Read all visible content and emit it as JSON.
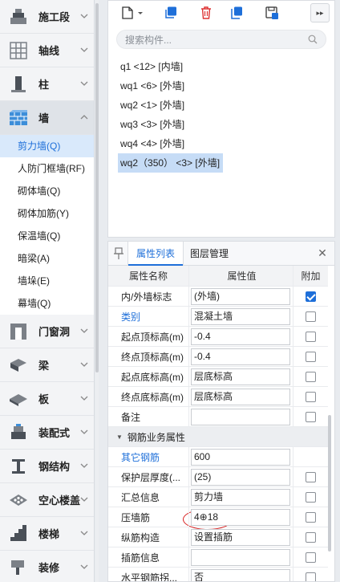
{
  "nav": {
    "categories_top": [
      {
        "label": "施工段",
        "icon": "construction-stage-icon"
      },
      {
        "label": "轴线",
        "icon": "grid-axis-icon"
      },
      {
        "label": "柱",
        "icon": "column-icon"
      }
    ],
    "active_category": {
      "label": "墙",
      "icon": "wall-icon"
    },
    "sub_items": [
      "剪力墙(Q)",
      "人防门框墙(RF)",
      "砌体墙(Q)",
      "砌体加筋(Y)",
      "保温墙(Q)",
      "暗梁(A)",
      "墙垛(E)",
      "幕墙(Q)"
    ],
    "selected_sub_index": 0,
    "categories_bottom": [
      {
        "label": "门窗洞",
        "icon": "door-window-icon"
      },
      {
        "label": "梁",
        "icon": "beam-icon"
      },
      {
        "label": "板",
        "icon": "slab-icon"
      },
      {
        "label": "装配式",
        "icon": "prefab-icon"
      },
      {
        "label": "钢结构",
        "icon": "steel-structure-icon"
      },
      {
        "label": "空心楼盖",
        "icon": "hollow-floor-icon"
      },
      {
        "label": "楼梯",
        "icon": "stair-icon"
      },
      {
        "label": "装修",
        "icon": "decoration-icon"
      }
    ]
  },
  "toolbar": {
    "buttons": [
      "new-component-icon",
      "copy-icon",
      "delete-icon",
      "layer-copy-icon",
      "save-template-icon"
    ],
    "more": "▸▸"
  },
  "search": {
    "placeholder": "搜索构件..."
  },
  "components": [
    "q1 <12> [内墙]",
    "wq1 <6> [外墙]",
    "wq2 <1> [外墙]",
    "wq3 <3> [外墙]",
    "wq4 <4> [外墙]",
    "wq2（350） <3> [外墙]"
  ],
  "selected_component_index": 5,
  "properties": {
    "tabs": [
      "属性列表",
      "图层管理"
    ],
    "active_tab": 0,
    "headers": {
      "name": "属性名称",
      "value": "属性值",
      "add": "附加"
    },
    "rows": [
      {
        "name": "内/外墙标志",
        "value": "(外墙)",
        "checked": true,
        "blue": false
      },
      {
        "name": "类别",
        "value": "混凝土墙",
        "checked": false,
        "blue": true
      },
      {
        "name": "起点顶标高(m)",
        "value": "-0.4",
        "checked": false,
        "blue": false
      },
      {
        "name": "终点顶标高(m)",
        "value": "-0.4",
        "checked": false,
        "blue": false
      },
      {
        "name": "起点底标高(m)",
        "value": "层底标高",
        "checked": false,
        "blue": false
      },
      {
        "name": "终点底标高(m)",
        "value": "层底标高",
        "checked": false,
        "blue": false
      },
      {
        "name": "备注",
        "value": "",
        "checked": false,
        "blue": false
      }
    ],
    "group_label": "钢筋业务属性",
    "group_rows": [
      {
        "name": "其它钢筋",
        "value": "600",
        "checked": null,
        "blue": true
      },
      {
        "name": "保护层厚度(...",
        "value": "(25)",
        "checked": false,
        "blue": false
      },
      {
        "name": "汇总信息",
        "value": "剪力墙",
        "checked": false,
        "blue": false
      },
      {
        "name": "压墙筋",
        "value": "4⊕18",
        "checked": false,
        "blue": false,
        "highlight": true
      },
      {
        "name": "纵筋构造",
        "value": "设置插筋",
        "checked": false,
        "blue": false
      },
      {
        "name": "插筋信息",
        "value": "",
        "checked": false,
        "blue": false
      },
      {
        "name": "水平钢筋拐...",
        "value": "否",
        "checked": false,
        "blue": false
      }
    ]
  },
  "colors": {
    "accent": "#1e6fd9",
    "selected_bg": "#c6dcf6",
    "highlight_ring": "#d82020"
  }
}
